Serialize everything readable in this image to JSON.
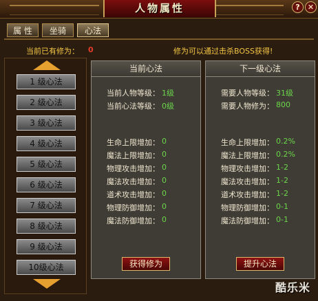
{
  "window": {
    "title": "人物属性",
    "help_label": "?",
    "close_label": "✕"
  },
  "tabs": [
    {
      "label": "属 性"
    },
    {
      "label": "坐骑"
    },
    {
      "label": "心法"
    }
  ],
  "info": {
    "current_label": "当前已有修为：",
    "current_value": "0",
    "hint": "修为可以通过击杀BOSS获得!"
  },
  "levels": [
    {
      "label": "1 级心法"
    },
    {
      "label": "2 级心法"
    },
    {
      "label": "3 级心法"
    },
    {
      "label": "4 级心法"
    },
    {
      "label": "5 级心法"
    },
    {
      "label": "6 级心法"
    },
    {
      "label": "7 级心法"
    },
    {
      "label": "8 级心法"
    },
    {
      "label": "9 级心法"
    },
    {
      "label": "10级心法"
    }
  ],
  "current": {
    "header": "当前心法",
    "req": [
      {
        "label": "当前人物等级：",
        "value": "1级"
      },
      {
        "label": "当前心法等级：",
        "value": "0级"
      }
    ],
    "bonus": [
      {
        "label": "生命上限增加：",
        "value": "0"
      },
      {
        "label": "魔法上限增加：",
        "value": "0"
      },
      {
        "label": "物理攻击增加：",
        "value": "0"
      },
      {
        "label": "魔法攻击增加：",
        "value": "0"
      },
      {
        "label": "道术攻击增加：",
        "value": "0"
      },
      {
        "label": "物理防御增加：",
        "value": "0"
      },
      {
        "label": "魔法防御增加：",
        "value": "0"
      }
    ],
    "button": "获得修为"
  },
  "next": {
    "header": "下一级心法",
    "req": [
      {
        "label": "需要人物等级：",
        "value": "31级"
      },
      {
        "label": "需要人物修为：",
        "value": "800"
      }
    ],
    "bonus": [
      {
        "label": "生命上限增加：",
        "value": "0.2%"
      },
      {
        "label": "魔法上限增加：",
        "value": "0.2%"
      },
      {
        "label": "物理攻击增加：",
        "value": "1-2"
      },
      {
        "label": "魔法攻击增加：",
        "value": "1-2"
      },
      {
        "label": "道术攻击增加：",
        "value": "1-2"
      },
      {
        "label": "物理防御增加：",
        "value": "0-1"
      },
      {
        "label": "魔法防御增加：",
        "value": "0-1"
      }
    ],
    "button": "提升心法"
  },
  "watermark": "酷乐米"
}
